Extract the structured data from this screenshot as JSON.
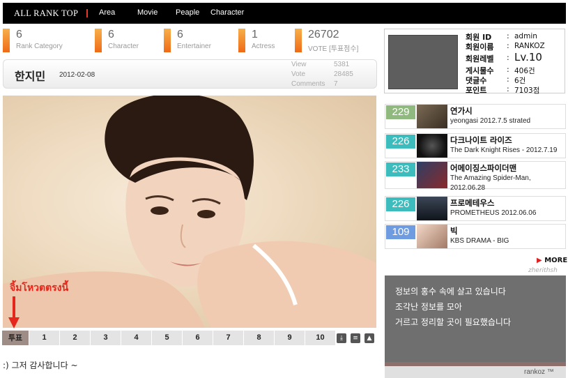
{
  "nav": {
    "brand": "ALL RANK TOP",
    "items": [
      "Area",
      "Movie",
      "Peaple",
      "Character"
    ]
  },
  "stats": [
    {
      "value": "6",
      "label": "Rank Category"
    },
    {
      "value": "6",
      "label": "Character"
    },
    {
      "value": "6",
      "label": "Entertainer"
    },
    {
      "value": "1",
      "label": "Actress"
    },
    {
      "value": "26702",
      "label": "VOTE [투표점수]"
    }
  ],
  "entry": {
    "name": "한지민",
    "date": "2012-02-08",
    "meta": [
      {
        "label": "View",
        "value": "5381"
      },
      {
        "label": "Vote",
        "value": "28485"
      },
      {
        "label": "Comments",
        "value": "7"
      }
    ]
  },
  "annotation": "จิ้มโหวตตรงนี้",
  "vote": {
    "label": "투표",
    "numbers": [
      "1",
      "2",
      "3",
      "4",
      "5",
      "6",
      "7",
      "8",
      "9",
      "10"
    ]
  },
  "comment": ":) 그저 감사합니다 ~",
  "profile": {
    "rows": [
      {
        "label": "회원 ID",
        "value": "admin"
      },
      {
        "label": "회원이름",
        "value": "RANKOZ"
      },
      {
        "label": "회원레벨",
        "value": "Lv.10"
      },
      {
        "label": "게시물수",
        "value": "406건"
      },
      {
        "label": "댓글수",
        "value": "6건"
      },
      {
        "label": "포인트",
        "value": "7103점"
      }
    ]
  },
  "movies": [
    {
      "score": "229",
      "color": "#8fb97e",
      "title": "연가시",
      "sub": "yeongasi 2012.7.5 strated"
    },
    {
      "score": "226",
      "color": "#3cbcbc",
      "title": "다크나이트 라이즈",
      "sub": "The Dark Knight Rises - 2012.7.19"
    },
    {
      "score": "233",
      "color": "#3cbcbc",
      "title": "어메이징스파이더맨",
      "sub": "The Amazing Spider-Man, 2012.06.28"
    },
    {
      "score": "226",
      "color": "#3cbcbc",
      "title": "프로메테우스",
      "sub": "PROMETHEUS 2012.06.06"
    },
    {
      "score": "109",
      "color": "#6f9be0",
      "title": "빅",
      "sub": "KBS DRAMA - BIG"
    }
  ],
  "more_label": "MORE",
  "logo_small": "zherithsh",
  "quote": {
    "lines": [
      "정보의 홍수 속에 살고 있습니다",
      "조각난 정보를 모아",
      "거르고 정리할 곳이 필요했습니다"
    ],
    "signature": "rankoz ™"
  }
}
